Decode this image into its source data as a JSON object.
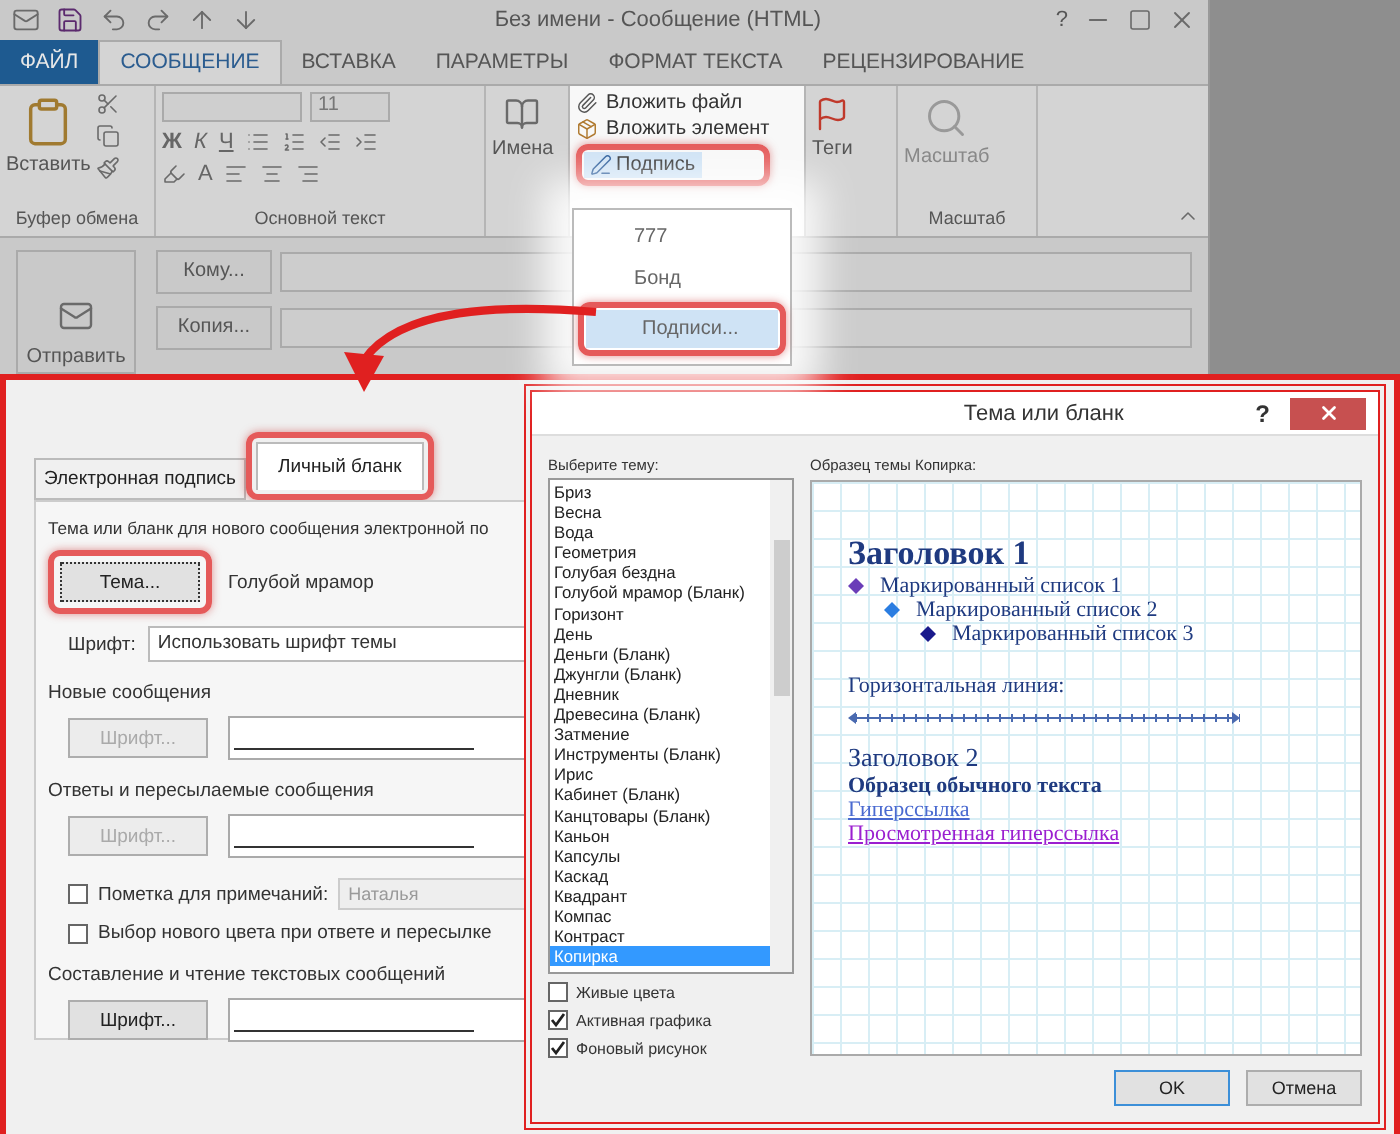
{
  "window": {
    "title": "Без имени - Сообщение (HTML)",
    "help_label": "?"
  },
  "ribbon_tabs": [
    {
      "label": "ФАЙЛ",
      "kind": "file",
      "selected": false
    },
    {
      "label": "СООБЩЕНИЕ",
      "kind": "tab",
      "selected": true
    },
    {
      "label": "ВСТАВКА",
      "kind": "tab",
      "selected": false
    },
    {
      "label": "ПАРАМЕТРЫ",
      "kind": "tab",
      "selected": false
    },
    {
      "label": "ФОРМАТ ТЕКСТА",
      "kind": "tab",
      "selected": false
    },
    {
      "label": "РЕЦЕНЗИРОВАНИЕ",
      "kind": "tab",
      "selected": false
    }
  ],
  "ribbon": {
    "clipboard": {
      "paste_label": "Вставить",
      "group_label": "Буфер обмена"
    },
    "basic_text": {
      "font_size": "11",
      "bold": "Ж",
      "italic": "К",
      "underline": "Ч",
      "font_color": "А",
      "group_label": "Основной текст"
    },
    "names": {
      "label": "Имена"
    },
    "include": {
      "attach_file": "Вложить файл",
      "attach_item": "Вложить элемент",
      "signature": "Подпись"
    },
    "tags": {
      "label": "Теги"
    },
    "zoom": {
      "label": "Масштаб",
      "group_label": "Масштаб"
    }
  },
  "signature_menu": {
    "items": [
      {
        "label": "777",
        "selected": false
      },
      {
        "label": "Бонд",
        "selected": false
      },
      {
        "label": "Подписи...",
        "selected": true
      }
    ]
  },
  "compose": {
    "send_label": "Отправить",
    "to_button": "Кому...",
    "cc_button": "Копия..."
  },
  "signature_dialog": {
    "tabs": [
      {
        "label": "Электронная подпись",
        "selected": false
      },
      {
        "label": "Личный бланк",
        "selected": true
      }
    ],
    "theme_caption": "Тема или бланк для нового сообщения электронной по",
    "theme_button": "Тема...",
    "theme_name": "Голубой мрамор",
    "font_label": "Шрифт:",
    "font_value": "Использовать шрифт темы",
    "sections": [
      {
        "title": "Новые сообщения",
        "button": "Шрифт...",
        "disabled": true
      },
      {
        "title": "Ответы и пересылаемые сообщения",
        "button": "Шрифт...",
        "disabled": true,
        "options": [
          {
            "label": "Пометка для примечаний:",
            "checked": false,
            "value": "Наталья"
          },
          {
            "label": "Выбор нового цвета при ответе и пересылке",
            "checked": false
          }
        ]
      },
      {
        "title": "Составление и чтение текстовых сообщений",
        "button": "Шрифт...",
        "disabled": false
      }
    ]
  },
  "theme_dialog": {
    "title": "Тема или бланк",
    "help_label": "?",
    "list_label": "Выберите тему:",
    "themes": [
      {
        "label": "Бриз",
        "selected": false
      },
      {
        "label": "Весна",
        "selected": false
      },
      {
        "label": "Вода",
        "selected": false
      },
      {
        "label": "Геометрия",
        "selected": false
      },
      {
        "label": "Голубая бездна",
        "selected": false
      },
      {
        "label": "Голубой мрамор (Бланк)",
        "selected": false
      },
      {
        "label": "Горизонт",
        "selected": false
      },
      {
        "label": "День",
        "selected": false
      },
      {
        "label": "Деньги (Бланк)",
        "selected": false
      },
      {
        "label": "Джунгли (Бланк)",
        "selected": false
      },
      {
        "label": "Дневник",
        "selected": false
      },
      {
        "label": "Древесина (Бланк)",
        "selected": false
      },
      {
        "label": "Затмение",
        "selected": false
      },
      {
        "label": "Инструменты (Бланк)",
        "selected": false
      },
      {
        "label": "Ирис",
        "selected": false
      },
      {
        "label": "Кабинет (Бланк)",
        "selected": false
      },
      {
        "label": "Канцтовары (Бланк)",
        "selected": false
      },
      {
        "label": "Каньон",
        "selected": false
      },
      {
        "label": "Капсулы",
        "selected": false
      },
      {
        "label": "Каскад",
        "selected": false
      },
      {
        "label": "Квадрант",
        "selected": false
      },
      {
        "label": "Компас",
        "selected": false
      },
      {
        "label": "Контраст",
        "selected": false
      },
      {
        "label": "Копирка",
        "selected": true
      }
    ],
    "options": [
      {
        "label": "Живые цвета",
        "checked": false
      },
      {
        "label": "Активная графика",
        "checked": true
      },
      {
        "label": "Фоновый рисунок",
        "checked": true
      }
    ],
    "preview_label": "Образец темы Копирка:",
    "preview": {
      "heading1": "Заголовок 1",
      "bullets": [
        {
          "label": "Маркированный список 1",
          "color": "#6a3db8"
        },
        {
          "label": "Маркированный список 2",
          "color": "#2a7de1"
        },
        {
          "label": "Маркированный список 3",
          "color": "#1a1a8c"
        }
      ],
      "hr_label": "Горизонтальная линия:",
      "heading2": "Заголовок 2",
      "body_text": "Образец обычного текста",
      "link": "Гиперссылка",
      "visited_link": "Просмотренная гиперссылка"
    },
    "buttons": [
      {
        "label": "OK",
        "kind": "default"
      },
      {
        "label": "Отмена",
        "kind": "normal"
      }
    ]
  }
}
